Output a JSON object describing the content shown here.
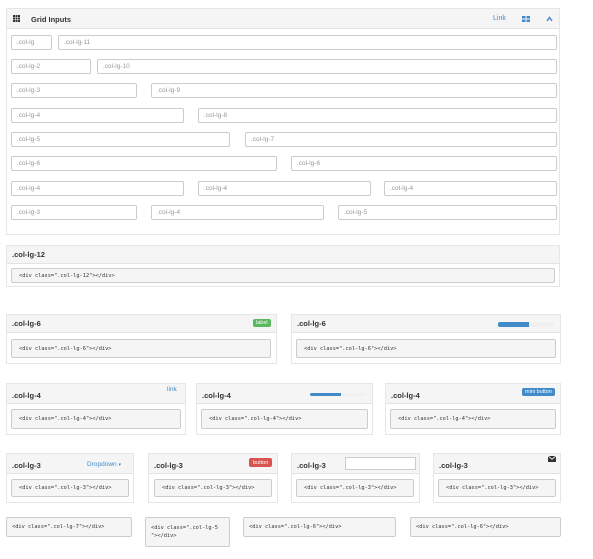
{
  "header": {
    "grid_icon": "grid-icon",
    "title": "Grid Inputs",
    "link_label": "Link",
    "layout_icon": "layout-icon",
    "collapse_icon": "chevron-up-icon"
  },
  "grid_inputs": {
    "row1": [
      ".col-lg",
      ".col-lg-11"
    ],
    "row2": [
      ".col-lg-2",
      ".col-lg-10"
    ],
    "row3": [
      ".col-lg-3",
      ".col-lg-9"
    ],
    "row4": [
      ".col-lg-4",
      ".col-lg-8"
    ],
    "row5": [
      ".col-lg-5",
      ".col-lg-7"
    ],
    "row6": [
      ".col-lg-6",
      ".col-lg-6"
    ],
    "row7": [
      ".col-lg-4",
      ".col-lg-4",
      ".col-lg-4"
    ],
    "row8": [
      ".col-lg-3",
      ".col-lg-4",
      ".col-lg-5"
    ]
  },
  "panels": {
    "p12": {
      "title": ".col-lg-12",
      "code": "<div class=\".col-lg-12\"></div>"
    },
    "p6a": {
      "title": ".col-lg-6",
      "badge": "label",
      "badge_color": "#5cb85c",
      "code": "<div class=\".col-lg-6\"></div>"
    },
    "p6b": {
      "title": ".col-lg-6",
      "progress": 0.55,
      "code": "<div class=\".col-lg-6\"></div>"
    },
    "p4a": {
      "title": ".col-lg-4",
      "link": "link",
      "code": "<div class=\".col-lg-4\"></div>"
    },
    "p4b": {
      "title": ".col-lg-4",
      "progress": 0.55,
      "code": "<div class=\".col-lg-4\"></div>"
    },
    "p4c": {
      "title": ".col-lg-4",
      "button": "mini button",
      "button_color": "#428bca",
      "code": "<div class=\".col-lg-4\"></div>"
    },
    "p3a": {
      "title": ".col-lg-3",
      "dropdown": "Dropdown",
      "code": "<div class=\".col-lg-3\"></div>"
    },
    "p3b": {
      "title": ".col-lg-3",
      "button": "button",
      "button_color": "#d9534f",
      "code": "<div class=\".col-lg-3\"></div>"
    },
    "p3c": {
      "title": ".col-lg-3",
      "input_value": "",
      "code": "<div class=\".col-lg-3\"></div>"
    },
    "p3d": {
      "title": ".col-lg-3",
      "icon": "envelope-icon",
      "code": "<div class=\".col-lg-3\"></div>"
    }
  },
  "bottom_codes": [
    "<div class=\".col-lg-7\"></div>",
    "<div class=\".col-lg-5\n\"></div>",
    "<div class=\".col-lg-6\"></div>",
    "<div class=\".col-lg-6\"></div>"
  ]
}
